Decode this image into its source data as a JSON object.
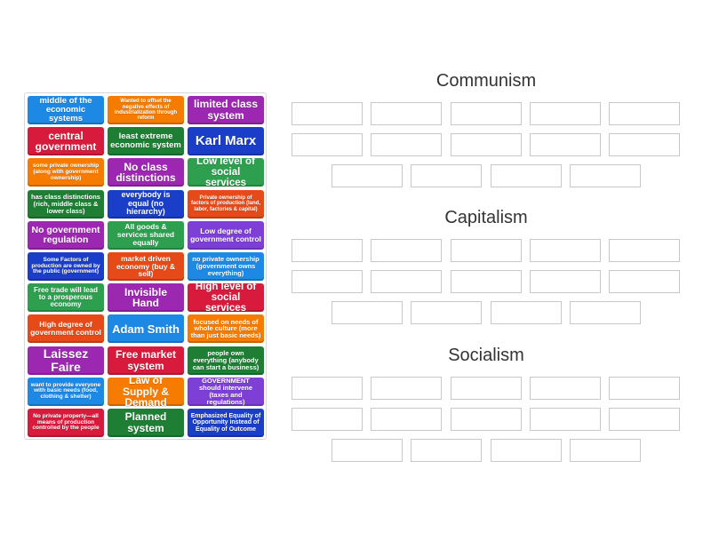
{
  "tiles": [
    {
      "text": "middle of the economic systems",
      "color": "#1e88e5",
      "size": 9.5
    },
    {
      "text": "Wanted to offset the negative effects of industrialization through reform",
      "color": "#f57c00",
      "size": 6
    },
    {
      "text": "limited class system",
      "color": "#9c27b0",
      "size": 12
    },
    {
      "text": "central government",
      "color": "#d81b3c",
      "size": 12
    },
    {
      "text": "least extreme economic system",
      "color": "#1e7e34",
      "size": 9.5
    },
    {
      "text": "Karl Marx",
      "color": "#1a3ec8",
      "size": 15
    },
    {
      "text": "some private ownership (along with government ownership)",
      "color": "#f57c00",
      "size": 6.5
    },
    {
      "text": "No class distinctions",
      "color": "#9c27b0",
      "size": 12
    },
    {
      "text": "Low level of social services",
      "color": "#2e9e4f",
      "size": 11.5
    },
    {
      "text": "has class distinctions (rich, middle class & lower class)",
      "color": "#1e7e34",
      "size": 7.5
    },
    {
      "text": "everybody is equal (no hierarchy)",
      "color": "#1a3ec8",
      "size": 9
    },
    {
      "text": "Private ownership of factors of production (land, labor, factories & capital)",
      "color": "#e64a19",
      "size": 6
    },
    {
      "text": "No government regulation",
      "color": "#9c27b0",
      "size": 10.5
    },
    {
      "text": "All goods & services shared equally",
      "color": "#2e9e4f",
      "size": 8.5
    },
    {
      "text": "Low degree of government control",
      "color": "#7e3fd6",
      "size": 8.5
    },
    {
      "text": "Some Factors of production are owned by the public (government)",
      "color": "#1a3ec8",
      "size": 6.5
    },
    {
      "text": "market driven economy (buy & sell)",
      "color": "#e64a19",
      "size": 8.5
    },
    {
      "text": "no private ownership (government owns everything)",
      "color": "#1e88e5",
      "size": 7.5
    },
    {
      "text": "Free trade will lead to a prosperous economy",
      "color": "#2e9e4f",
      "size": 8
    },
    {
      "text": "Invisible Hand",
      "color": "#9c27b0",
      "size": 12
    },
    {
      "text": "High level of social services",
      "color": "#d81b3c",
      "size": 11.5
    },
    {
      "text": "High degree of government control",
      "color": "#e64a19",
      "size": 8.5
    },
    {
      "text": "Adam Smith",
      "color": "#1e88e5",
      "size": 13
    },
    {
      "text": "focused on needs of whole culture (more than just basic needs)",
      "color": "#f57c00",
      "size": 7.5
    },
    {
      "text": "Laissez Faire",
      "color": "#9c27b0",
      "size": 14
    },
    {
      "text": "Free market system",
      "color": "#d81b3c",
      "size": 12
    },
    {
      "text": "people own everything (anybody can start a business)",
      "color": "#1e7e34",
      "size": 7.5
    },
    {
      "text": "want to provide everyone with basic needs (food, clothing & shelter)",
      "color": "#1e88e5",
      "size": 6.5
    },
    {
      "text": "Law of Supply & Demand",
      "color": "#f57c00",
      "size": 12
    },
    {
      "text": "GOVERNMENT should intervene (taxes and regulations)",
      "color": "#7e3fd6",
      "size": 7.5
    },
    {
      "text": "No private property—all means of production controlled by the people",
      "color": "#d81b3c",
      "size": 6.5
    },
    {
      "text": "Planned system",
      "color": "#1e7e34",
      "size": 12
    },
    {
      "text": "Emphasized Equality of Opportunity instead of Equality of Outcome",
      "color": "#1a3ec8",
      "size": 7
    }
  ],
  "groups": [
    {
      "title": "Communism",
      "slots": 12
    },
    {
      "title": "Capitalism",
      "slots": 12
    },
    {
      "title": "Socialism",
      "slots": 12
    }
  ]
}
